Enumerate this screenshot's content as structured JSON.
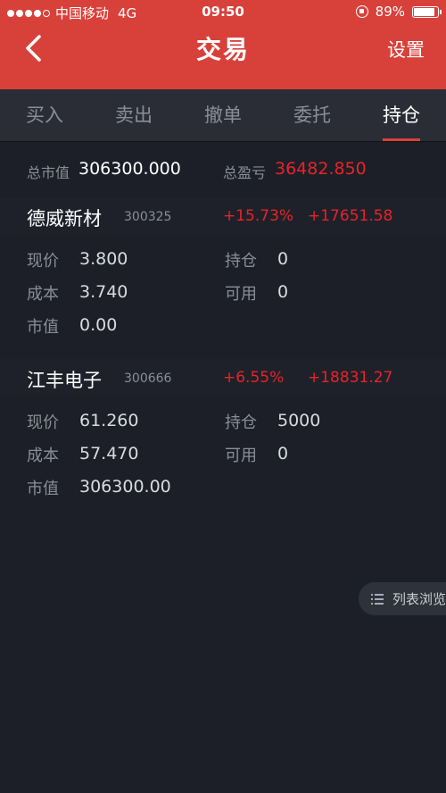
{
  "status_bar": {
    "carrier": "中国移动",
    "network": "4G",
    "time": "09:50",
    "battery": "89%"
  },
  "header": {
    "title": "交易",
    "settings_label": "设置"
  },
  "tabs": [
    {
      "label": "买入",
      "active": false
    },
    {
      "label": "卖出",
      "active": false
    },
    {
      "label": "撤单",
      "active": false
    },
    {
      "label": "委托",
      "active": false
    },
    {
      "label": "持仓",
      "active": true
    }
  ],
  "summary": {
    "market_value_label": "总市值",
    "market_value": "306300.000",
    "total_pl_label": "总盈亏",
    "total_pl": "36482.850"
  },
  "labels": {
    "price": "现价",
    "position": "持仓",
    "cost": "成本",
    "available": "可用",
    "value": "市值"
  },
  "stocks": [
    {
      "name": "德威新材",
      "code": "300325",
      "change_pct": "+15.73%",
      "profit": "+17651.58",
      "price": "3.800",
      "position": "0",
      "cost": "3.740",
      "available": "0",
      "value": "0.00"
    },
    {
      "name": "江丰电子",
      "code": "300666",
      "change_pct": "+6.55%",
      "profit": "+18831.27",
      "price": "61.260",
      "position": "5000",
      "cost": "57.470",
      "available": "0",
      "value": "306300.00"
    }
  ],
  "list_view_label": "列表浏览",
  "colors": {
    "brand_red": "#d8413a",
    "profit_red": "#e8232a",
    "background": "#1c1f27"
  }
}
